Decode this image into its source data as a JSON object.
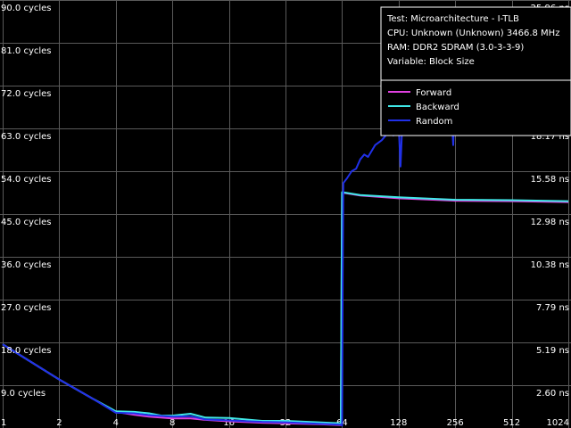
{
  "chart_data": {
    "type": "line",
    "title": "",
    "xlabel": "",
    "ylabel": "",
    "x_scale": "log2",
    "x_ticks": [
      1,
      2,
      4,
      8,
      16,
      32,
      64,
      128,
      256,
      512,
      1024
    ],
    "x_tick_labels": [
      "1",
      "2",
      "4",
      "8",
      "16",
      "32",
      "64",
      "128",
      "256",
      "512",
      "1024"
    ],
    "ylim": [
      0,
      90
    ],
    "y_ticks": [
      9,
      18,
      27,
      36,
      45,
      54,
      63,
      72,
      81,
      90
    ],
    "y_tick_labels_left": [
      "9.0 cycles",
      "18.0 cycles",
      "27.0 cycles",
      "36.0 cycles",
      "45.0 cycles",
      "54.0 cycles",
      "63.0 cycles",
      "72.0 cycles",
      "81.0 cycles",
      "90.0 cycles"
    ],
    "y_tick_labels_right": [
      "2.60 ns",
      "5.19 ns",
      "7.79 ns",
      "10.38 ns",
      "12.98 ns",
      "15.58 ns",
      "18.17 ns",
      "20.77 ns",
      "23.36 ns",
      "25.96 ns"
    ],
    "grid": true,
    "legend_position": "top-right",
    "info_lines": [
      "Test: Microarchitecture - I-TLB",
      "CPU: Unknown (Unknown) 3466.8 MHz",
      "RAM: DDR2 SDRAM (3.0-3-3-9)",
      "Variable: Block Size"
    ],
    "series": [
      {
        "name": "Forward",
        "color": "#e040e0",
        "points": [
          [
            1,
            17.6
          ],
          [
            2,
            10.2
          ],
          [
            3,
            6.2
          ],
          [
            4,
            3.4
          ],
          [
            5,
            2.8
          ],
          [
            6,
            2.4
          ],
          [
            8,
            2.0
          ],
          [
            10,
            2.0
          ],
          [
            12,
            1.7
          ],
          [
            16,
            1.4
          ],
          [
            24,
            1.1
          ],
          [
            32,
            1.0
          ],
          [
            48,
            0.8
          ],
          [
            63,
            0.6
          ],
          [
            64,
            49.5
          ],
          [
            80,
            48.9
          ],
          [
            128,
            48.3
          ],
          [
            256,
            47.8
          ],
          [
            512,
            47.7
          ],
          [
            1024,
            47.5
          ]
        ]
      },
      {
        "name": "Backward",
        "color": "#40e8e8",
        "points": [
          [
            1,
            17.6
          ],
          [
            2,
            10.2
          ],
          [
            3,
            6.2
          ],
          [
            4,
            3.5
          ],
          [
            5,
            3.4
          ],
          [
            6,
            3.1
          ],
          [
            7,
            2.6
          ],
          [
            8,
            2.6
          ],
          [
            10,
            3.0
          ],
          [
            12,
            2.2
          ],
          [
            16,
            2.1
          ],
          [
            24,
            1.5
          ],
          [
            32,
            1.5
          ],
          [
            48,
            1.2
          ],
          [
            63,
            1.0
          ],
          [
            64,
            49.6
          ],
          [
            80,
            49.0
          ],
          [
            128,
            48.5
          ],
          [
            256,
            48.0
          ],
          [
            512,
            47.9
          ],
          [
            1024,
            47.7
          ]
        ]
      },
      {
        "name": "Random",
        "color": "#2030e8",
        "points": [
          [
            1,
            17.6
          ],
          [
            2,
            10.2
          ],
          [
            3,
            6.2
          ],
          [
            4,
            3.2
          ],
          [
            5,
            3.1
          ],
          [
            6,
            2.7
          ],
          [
            8,
            2.4
          ],
          [
            10,
            2.5
          ],
          [
            12,
            1.8
          ],
          [
            16,
            1.6
          ],
          [
            24,
            1.3
          ],
          [
            32,
            1.2
          ],
          [
            48,
            0.9
          ],
          [
            63,
            0.7
          ],
          [
            64,
            0.5
          ],
          [
            64.5,
            31.0
          ],
          [
            65,
            51.5
          ],
          [
            68,
            52.5
          ],
          [
            72,
            54.0
          ],
          [
            76,
            54.5
          ],
          [
            80,
            56.5
          ],
          [
            84,
            57.5
          ],
          [
            88,
            57.0
          ],
          [
            96,
            59.5
          ],
          [
            104,
            60.5
          ],
          [
            112,
            62.0
          ],
          [
            120,
            61.5
          ],
          [
            128,
            64.0
          ],
          [
            131,
            55.0
          ],
          [
            134,
            64.5
          ],
          [
            144,
            65.5
          ],
          [
            160,
            66.5
          ],
          [
            176,
            67.5
          ],
          [
            192,
            68.0
          ],
          [
            208,
            69.5
          ],
          [
            224,
            70.0
          ],
          [
            240,
            72.0
          ],
          [
            250,
            59.5
          ],
          [
            256,
            72.5
          ],
          [
            288,
            73.5
          ],
          [
            320,
            75.5
          ],
          [
            352,
            77.0
          ],
          [
            384,
            78.0
          ],
          [
            400,
            73.0
          ],
          [
            416,
            79.0
          ],
          [
            448,
            80.0
          ],
          [
            512,
            80.5
          ],
          [
            640,
            80.5
          ],
          [
            800,
            80.0
          ],
          [
            960,
            79.5
          ],
          [
            1024,
            79.5
          ]
        ]
      }
    ]
  }
}
